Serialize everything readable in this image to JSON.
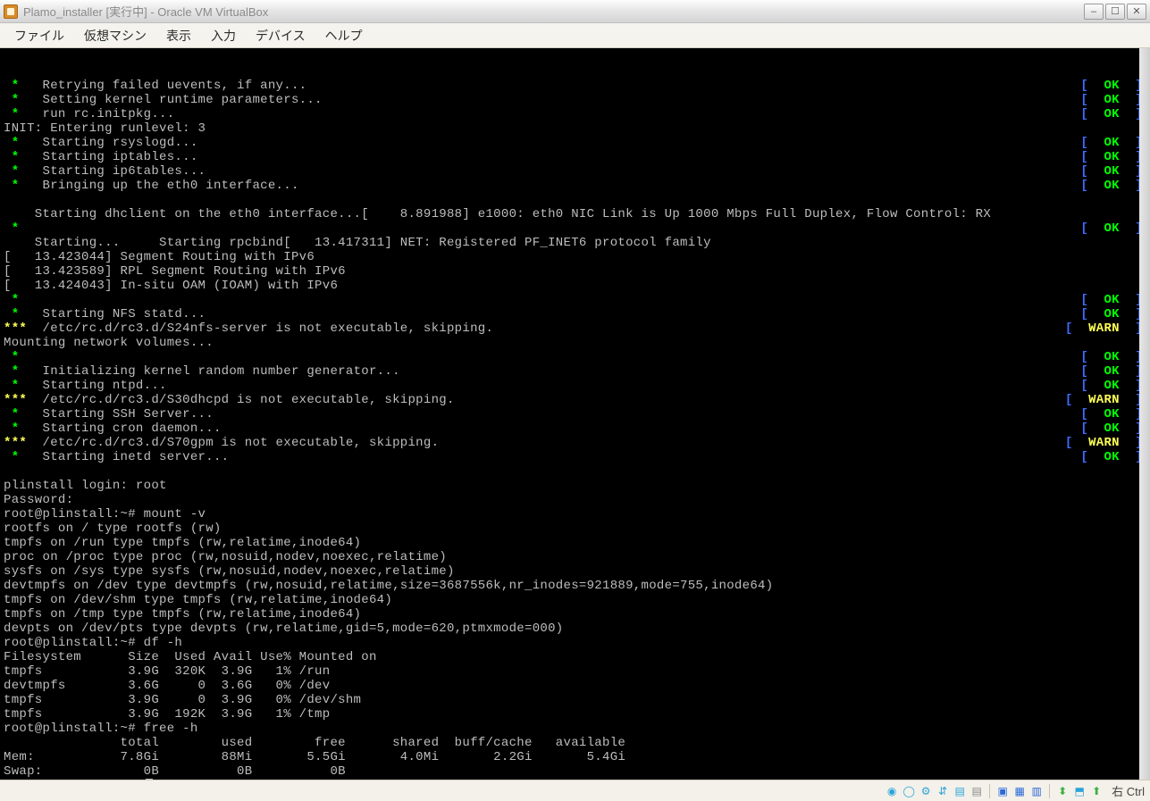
{
  "window": {
    "title": "Plamo_installer [実行中] - Oracle VM VirtualBox",
    "buttons": {
      "min": "–",
      "max": "☐",
      "close": "✕"
    }
  },
  "menubar": {
    "items": [
      "ファイル",
      "仮想マシン",
      "表示",
      "入力",
      "デバイス",
      "ヘルプ"
    ]
  },
  "statusbar": {
    "host_key": "右 Ctrl",
    "icons": [
      "disk-icon",
      "optical-icon",
      "network-icon",
      "usb-icon",
      "shared-folder-icon",
      "audio-icon",
      "display-icon",
      "recording-icon",
      "cpu-icon",
      "mouse-icon",
      "clipboard-icon",
      "drag-icon"
    ]
  },
  "terminal": {
    "boot": [
      {
        "ast": "g",
        "text": "Retrying failed uevents, if any...",
        "status": "OK"
      },
      {
        "ast": "g",
        "text": "Setting kernel runtime parameters...",
        "status": "OK"
      },
      {
        "ast": "g",
        "text": "run rc.initpkg...",
        "status": "OK"
      },
      {
        "plain": "INIT: Entering runlevel: 3"
      },
      {
        "ast": "g",
        "text": "Starting rsyslogd...",
        "status": "OK"
      },
      {
        "ast": "g",
        "text": "Starting iptables...",
        "status": "OK"
      },
      {
        "ast": "g",
        "text": "Starting ip6tables...",
        "status": "OK"
      },
      {
        "ast": "g",
        "text": "Bringing up the eth0 interface...",
        "status": "OK"
      },
      {
        "plain": ""
      },
      {
        "plain": "    Starting dhclient on the eth0 interface...[    8.891988] e1000: eth0 NIC Link is Up 1000 Mbps Full Duplex, Flow Control: RX"
      },
      {
        "ast": "g",
        "text": "",
        "status": "OK"
      },
      {
        "plain": "    Starting...     Starting rpcbind[   13.417311] NET: Registered PF_INET6 protocol family"
      },
      {
        "plain": "[   13.423044] Segment Routing with IPv6"
      },
      {
        "plain": "[   13.423589] RPL Segment Routing with IPv6"
      },
      {
        "plain": "[   13.424043] In-situ OAM (IOAM) with IPv6"
      },
      {
        "ast": "g",
        "text": "",
        "status": "OK"
      },
      {
        "ast": "g",
        "text": "Starting NFS statd...",
        "status": "OK"
      },
      {
        "ast": "y",
        "text": "/etc/rc.d/rc3.d/S24nfs-server is not executable, skipping.",
        "status": "WARN"
      },
      {
        "plain": "Mounting network volumes..."
      },
      {
        "ast": "g",
        "text": "",
        "status": "OK"
      },
      {
        "ast": "g",
        "text": "Initializing kernel random number generator...",
        "status": "OK"
      },
      {
        "ast": "g",
        "text": "Starting ntpd...",
        "status": "OK"
      },
      {
        "ast": "y",
        "text": "/etc/rc.d/rc3.d/S30dhcpd is not executable, skipping.",
        "status": "WARN"
      },
      {
        "ast": "g",
        "text": "Starting SSH Server...",
        "status": "OK"
      },
      {
        "ast": "g",
        "text": "Starting cron daemon...",
        "status": "OK"
      },
      {
        "ast": "y",
        "text": "/etc/rc.d/rc3.d/S70gpm is not executable, skipping.",
        "status": "WARN"
      },
      {
        "ast": "g",
        "text": "Starting inetd server...",
        "status": "OK"
      }
    ],
    "session": [
      "",
      "plinstall login: root",
      "Password:",
      "root@plinstall:~# mount -v",
      "rootfs on / type rootfs (rw)",
      "tmpfs on /run type tmpfs (rw,relatime,inode64)",
      "proc on /proc type proc (rw,nosuid,nodev,noexec,relatime)",
      "sysfs on /sys type sysfs (rw,nosuid,nodev,noexec,relatime)",
      "devtmpfs on /dev type devtmpfs (rw,nosuid,relatime,size=3687556k,nr_inodes=921889,mode=755,inode64)",
      "tmpfs on /dev/shm type tmpfs (rw,relatime,inode64)",
      "tmpfs on /tmp type tmpfs (rw,relatime,inode64)",
      "devpts on /dev/pts type devpts (rw,relatime,gid=5,mode=620,ptmxmode=000)",
      "root@plinstall:~# df -h",
      "Filesystem      Size  Used Avail Use% Mounted on",
      "tmpfs           3.9G  320K  3.9G   1% /run",
      "devtmpfs        3.6G     0  3.6G   0% /dev",
      "tmpfs           3.9G     0  3.9G   0% /dev/shm",
      "tmpfs           3.9G  192K  3.9G   1% /tmp",
      "root@plinstall:~# free -h",
      "               total        used        free      shared  buff/cache   available",
      "Mem:           7.8Gi        88Mi       5.5Gi       4.0Mi       2.2Gi       5.4Gi",
      "Swap:             0B          0B          0B",
      "root@plinstall:~# "
    ]
  }
}
